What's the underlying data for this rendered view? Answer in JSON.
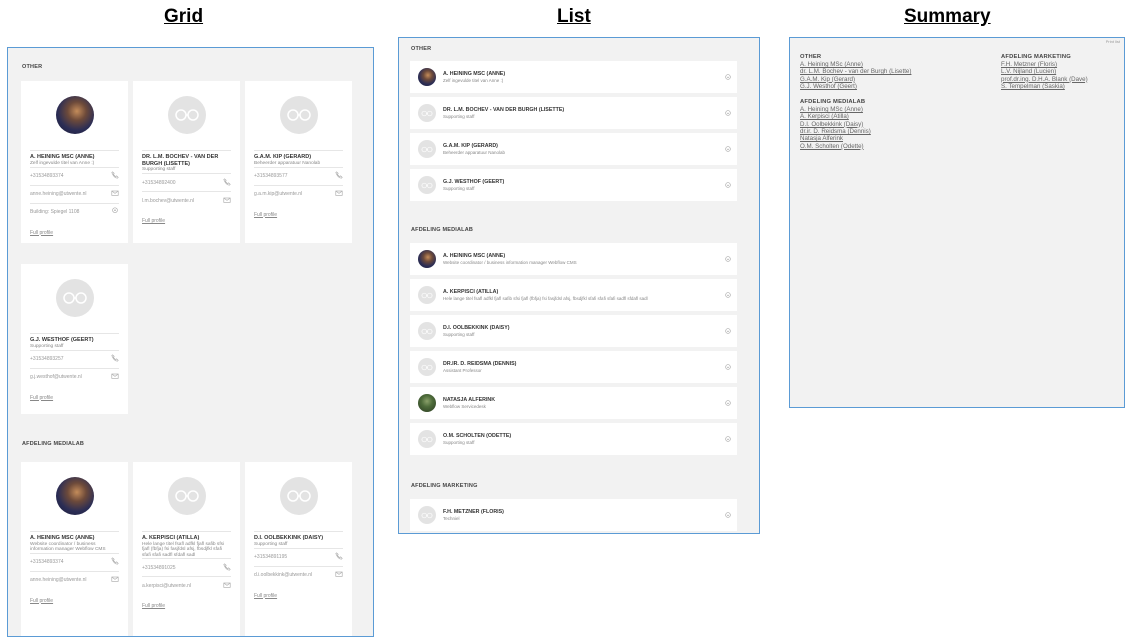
{
  "headings": {
    "grid": "Grid",
    "list": "List",
    "summary": "Summary"
  },
  "grid": {
    "sections": [
      {
        "title": "OTHER",
        "cards": [
          {
            "name": "A. HEINING MSC (ANNE)",
            "function": "Zelf ingevulde titel van Anne :)",
            "photo": true,
            "phone": "+31534893374",
            "email": "anne.heining@utwente.nl",
            "location": "Building: Spiegel 1108",
            "link": "Full profile"
          },
          {
            "name": "DR. L.M. BOCHEV - VAN DER BURGH (LISETTE)",
            "function": "Supporting staff",
            "photo": false,
            "phone": "+31534892400",
            "email": "l.m.bochev@utwente.nl",
            "link": "Full profile"
          },
          {
            "name": "G.A.M. KIP (GERARD)",
            "function": "Beheerder apparatuur Nanolab",
            "photo": false,
            "phone": "+31534893577",
            "email": "g.a.m.kip@utwente.nl",
            "link": "Full profile"
          },
          {
            "name": "G.J. WESTHOF (GEERT)",
            "function": "Supporting staff",
            "photo": false,
            "phone": "+31534893257",
            "email": "g.j.westhof@utwente.nl",
            "link": "Full profile"
          }
        ]
      },
      {
        "title": "AFDELING MEDIALAB",
        "cards": [
          {
            "name": "A. HEINING MSC (ANNE)",
            "function": "Website coordinator / business information manager Webflow CMS",
            "photo": true,
            "phone": "+31534893374",
            "email": "anne.heining@utwente.nl",
            "link": "Full profile"
          },
          {
            "name": "A. KERPISCI (ATILLA)",
            "function": "Hele lange titel fsafl adfkl fjafl safib sfsi fjafl (fbfja) fsi fasjfdsl afsj, fbsdjfkl sfafi sfafi sfafi sadfl sfdafl sadl",
            "photo": false,
            "phone": "+31534891025",
            "email": "a.kerpisci@utwente.nl",
            "link": "Full profile"
          },
          {
            "name": "D.I. OOLBEKKINK (DAISY)",
            "function": "Supporting staff",
            "photo": false,
            "phone": "+31534891195",
            "email": "d.i.oolbekkink@utwente.nl",
            "link": "Full profile"
          }
        ]
      }
    ]
  },
  "list": {
    "sections": [
      {
        "title": "OTHER",
        "items": [
          {
            "name": "A. HEINING MSC (ANNE)",
            "function": "Zelf ingevulde titel van Anne :)",
            "avatar": "photo"
          },
          {
            "name": "DR. L.M. BOCHEV - VAN DER BURGH (LISETTE)",
            "function": "Supporting staff",
            "avatar": "placeholder"
          },
          {
            "name": "G.A.M. KIP (GERARD)",
            "function": "Beheerder apparatuur Nanolab",
            "avatar": "placeholder"
          },
          {
            "name": "G.J. WESTHOF (GEERT)",
            "function": "Supporting staff",
            "avatar": "placeholder"
          }
        ]
      },
      {
        "title": "AFDELING MEDIALAB",
        "items": [
          {
            "name": "A. HEINING MSC (ANNE)",
            "function": "Website coordinator / business information manager Webflow CMS",
            "avatar": "photo"
          },
          {
            "name": "A. KERPISCI (ATILLA)",
            "function": "Hele lange titel fsafl adfkl fjafl safib sfsi fjafl (fbfja) fsi fasjfdsl afsj, fbsdjfkl sfafi sfafi sfafi sadfl sfdafl sadl",
            "avatar": "placeholder"
          },
          {
            "name": "D.I. OOLBEKKINK (DAISY)",
            "function": "Supporting staff",
            "avatar": "placeholder"
          },
          {
            "name": "DR.IR. D. REIDSMA (DENNIS)",
            "function": "Assistant Professor",
            "avatar": "placeholder"
          },
          {
            "name": "NATASJA ALFERINK",
            "function": "Webflow Servicedesk",
            "avatar": "photo-green"
          },
          {
            "name": "O.M. SCHOLTEN (ODETTE)",
            "function": "Supporting staff",
            "avatar": "placeholder"
          }
        ]
      },
      {
        "title": "AFDELING MARKETING",
        "items": [
          {
            "name": "F.H. METZNER (FLORIS)",
            "function": "Techniel",
            "avatar": "placeholder"
          }
        ]
      }
    ]
  },
  "summary": {
    "corner": "Print list",
    "columns": [
      [
        {
          "title": "OTHER",
          "people": [
            "A. Heining MSc (Anne)",
            "dr. L.M. Bochev - van der Burgh (Lisette)",
            "G.A.M. Kip (Gerard)",
            "G.J. Westhof (Geert)"
          ]
        },
        {
          "title": "AFDELING MEDIALAB",
          "people": [
            "A. Heining MSc (Anne)",
            "A. Kerpisci (Atilla)",
            "D.I. Oolbekkink (Daisy)",
            "dr.ir. D. Reidsma (Dennis)",
            "Natasja Alferink",
            "O.M. Scholten (Odette)"
          ]
        }
      ],
      [
        {
          "title": "AFDELING MARKETING",
          "people": [
            "F.H. Metzner (Floris)",
            "L.V. Nijland (Lucien)",
            "prof.dr.ing. D.H.A. Blank (Dave)",
            "S. Tempelman (Saskia)"
          ]
        }
      ]
    ]
  }
}
